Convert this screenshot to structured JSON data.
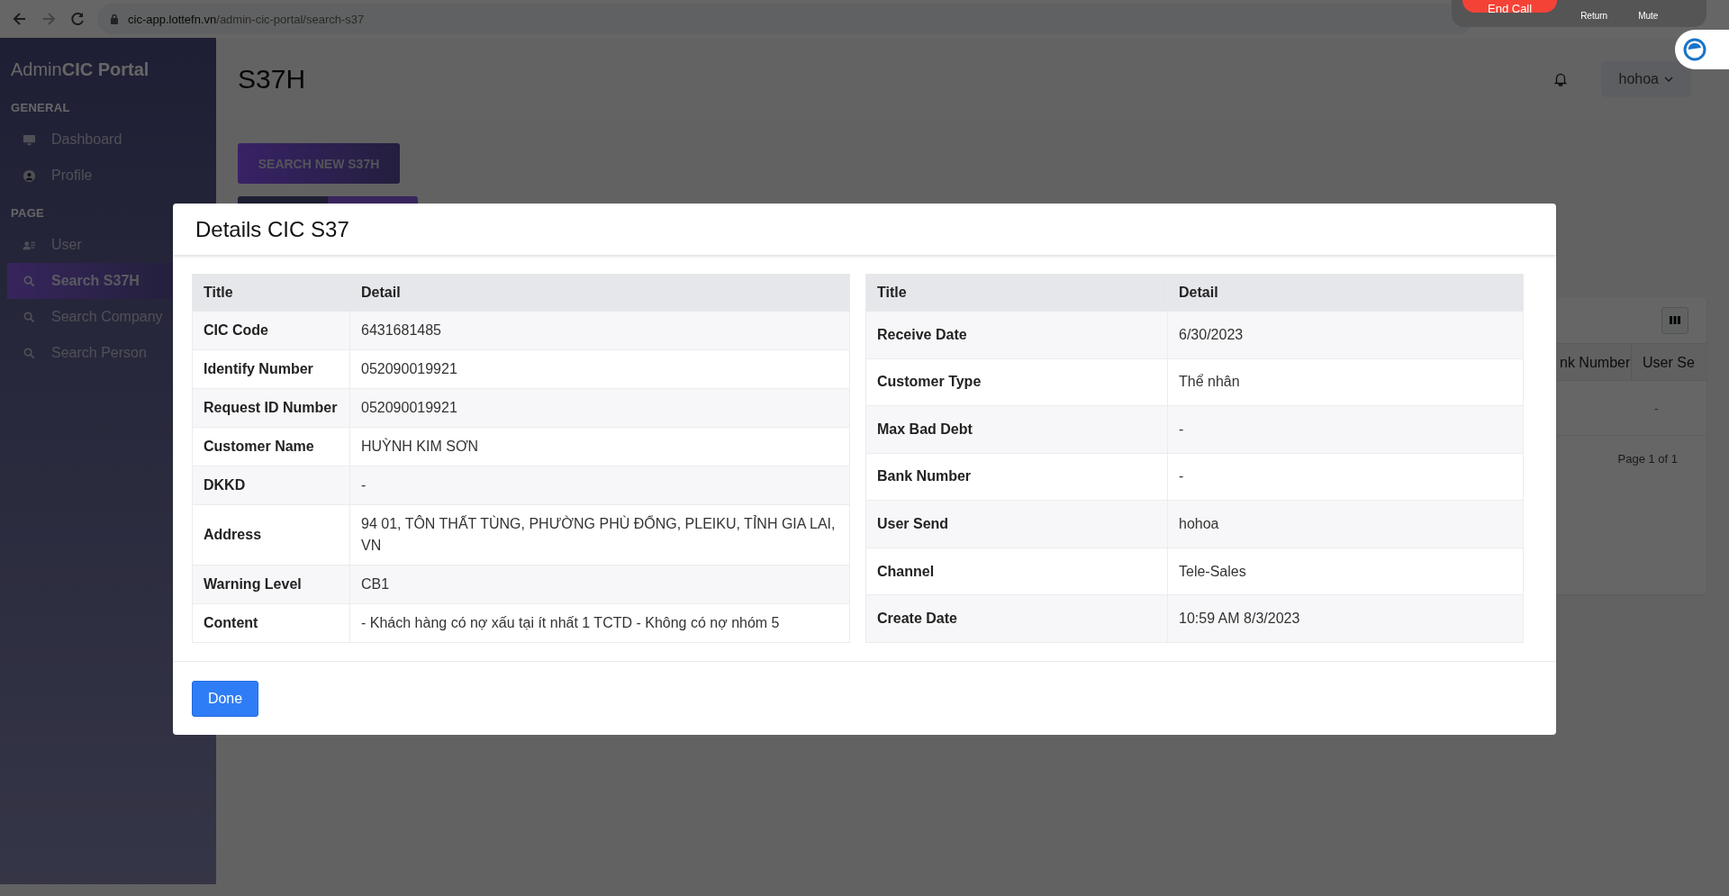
{
  "browser": {
    "url_host": "cic-app.lottefn.vn",
    "url_path": "/admin-cic-portal/search-s37",
    "call_bar": {
      "end_call": "End Call",
      "buttons": [
        "Return",
        "Mute"
      ]
    }
  },
  "sidebar": {
    "brand_light": "Admin",
    "brand_bold": "CIC Portal",
    "sections": [
      {
        "heading": "GENERAL",
        "items": [
          {
            "label": "Dashboard",
            "kind": "monitor",
            "selected": false
          },
          {
            "label": "Profile",
            "kind": "profile",
            "selected": false
          }
        ]
      },
      {
        "heading": "PAGE",
        "items": [
          {
            "label": "User",
            "kind": "users",
            "selected": false
          },
          {
            "label": "Search S37H",
            "kind": "search",
            "selected": true
          },
          {
            "label": "Search Company",
            "kind": "search",
            "selected": false
          },
          {
            "label": "Search Person",
            "kind": "search",
            "selected": false
          }
        ]
      }
    ]
  },
  "header": {
    "title": "S37H",
    "user": "hohoa"
  },
  "page": {
    "search_button": "SEARCH NEW S37H",
    "table": {
      "columns": [
        "nk Number",
        "User Se"
      ],
      "row": [
        "-"
      ]
    },
    "pagination": "Page 1 of 1"
  },
  "modal": {
    "title": "Details CIC S37",
    "tables": [
      {
        "columns": [
          "Title",
          "Detail"
        ],
        "rows": [
          [
            "CIC Code",
            "6431681485"
          ],
          [
            "Identify Number",
            "052090019921"
          ],
          [
            "Request ID Number",
            "052090019921"
          ],
          [
            "Customer Name",
            "HUỲNH KIM SƠN"
          ],
          [
            "DKKD",
            "-"
          ],
          [
            "Address",
            "94 01, TÔN THẤT TÙNG, PHƯỜNG PHÙ ĐỔNG, PLEIKU, TỈNH GIA LAI, VN"
          ],
          [
            "Warning Level",
            "CB1"
          ],
          [
            "Content",
            "- Khách hàng có nợ xấu tại ít nhất 1 TCTD - Không có nợ nhóm 5"
          ]
        ]
      },
      {
        "columns": [
          "Title",
          "Detail"
        ],
        "rows": [
          [
            "Receive Date",
            "6/30/2023"
          ],
          [
            "Customer Type",
            "Thể nhân"
          ],
          [
            "Max Bad Debt",
            "-"
          ],
          [
            "Bank Number",
            "-"
          ],
          [
            "User Send",
            "hohoa"
          ],
          [
            "Channel",
            "Tele-Sales"
          ],
          [
            "Create Date",
            "10:59 AM 8/3/2023"
          ]
        ]
      }
    ],
    "done": "Done"
  }
}
